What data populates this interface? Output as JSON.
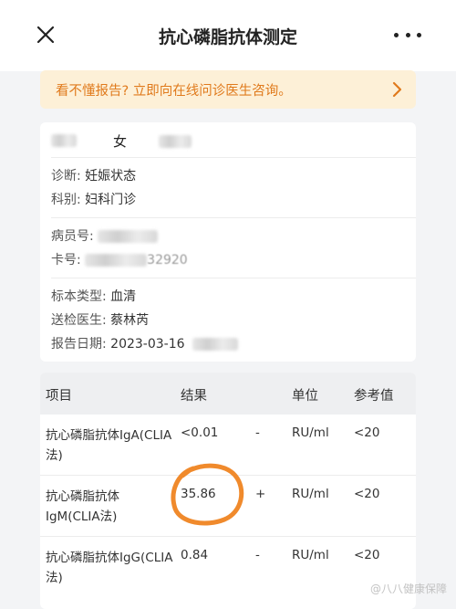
{
  "header": {
    "title": "抗心磷脂抗体测定"
  },
  "banner": {
    "text": "看不懂报告? 立即向在线问诊医生咨询。"
  },
  "patient": {
    "gender": "女",
    "diagnosis_label": "诊断:",
    "diagnosis_value": "妊娠状态",
    "department_label": "科别:",
    "department_value": "妇科门诊",
    "patient_no_label": "病员号:",
    "card_no_label": "卡号:",
    "card_no_visible": "32920",
    "sample_type_label": "标本类型:",
    "sample_type_value": "血清",
    "doctor_label": "送检医生:",
    "doctor_value": "蔡林芮",
    "report_date_label": "报告日期:",
    "report_date_value": "2023-03-16"
  },
  "results_table": {
    "headers": {
      "item": "项目",
      "result": "结果",
      "unit": "单位",
      "reference": "参考值"
    },
    "rows": [
      {
        "name": "抗心磷脂抗体IgA(CLIA法)",
        "result": "<0.01",
        "flag": "-",
        "unit": "RU/ml",
        "reference": "<20"
      },
      {
        "name": "抗心磷脂抗体IgM(CLIA法)",
        "result": "35.86",
        "flag": "+",
        "unit": "RU/ml",
        "reference": "<20"
      },
      {
        "name": "抗心磷脂抗体IgG(CLIA法)",
        "result": "0.84",
        "flag": "-",
        "unit": "RU/ml",
        "reference": "<20"
      }
    ]
  },
  "annotation": {
    "circle_color": "#f08a2c"
  },
  "watermark": {
    "text": "@八八健康保障"
  }
}
